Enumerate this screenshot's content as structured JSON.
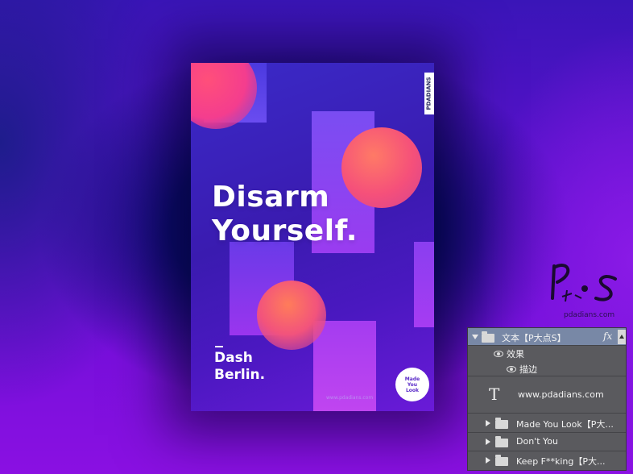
{
  "poster": {
    "brand": "PDADIANS",
    "headline_line1": "Disarm",
    "headline_line2": "Yourself.",
    "artist_line1": "Dash",
    "artist_line2": "Berlin.",
    "url": "www.pdadians.com",
    "badge": "Made\nYou\nLook"
  },
  "watermark": {
    "url": "pdadians.com"
  },
  "layers_panel": {
    "group_name": "文本【P大点S】",
    "fx_label": "fx",
    "effects_label": "效果",
    "stroke_label": "描边",
    "text_layer": "www.pdadians.com",
    "groups": [
      {
        "name": "Made You Look【P大..."
      },
      {
        "name": "Don't You"
      },
      {
        "name": "Keep F**king【P大..."
      }
    ]
  },
  "colors": {
    "accent_pink": "#f5507a",
    "panel_bg": "#5a5a5e",
    "selected_row": "#7888a6"
  }
}
